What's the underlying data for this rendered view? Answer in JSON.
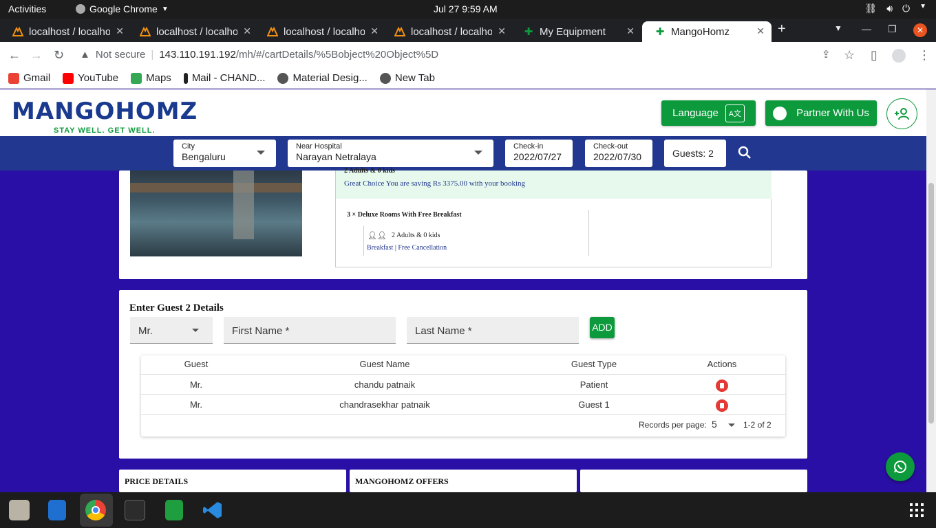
{
  "system_bar": {
    "activities": "Activities",
    "app_name": "Google Chrome",
    "clock": "Jul 27  9:59 AM"
  },
  "tabs": [
    {
      "title": "localhost / localhost",
      "active": false
    },
    {
      "title": "localhost / localhost",
      "active": false
    },
    {
      "title": "localhost / localhost",
      "active": false
    },
    {
      "title": "localhost / localhost",
      "active": false
    },
    {
      "title": "My Equipment",
      "active": false
    },
    {
      "title": "MangoHomz",
      "active": true
    }
  ],
  "omnibox": {
    "security": "Not secure",
    "url_host": "143.110.191.192",
    "url_path": "/mh/#/cartDetails/%5Bobject%20Object%5D"
  },
  "bookmarks": [
    {
      "label": "Gmail",
      "icon": "gmail-icon",
      "color": "#ea4335"
    },
    {
      "label": "YouTube",
      "icon": "youtube-icon",
      "color": "#ff0000"
    },
    {
      "label": "Maps",
      "icon": "maps-icon",
      "color": "#34a853"
    },
    {
      "label": "Mail - CHAND...",
      "icon": "mail-icon",
      "color": "#222222"
    },
    {
      "label": "Material Desig...",
      "icon": "globe-icon",
      "color": "#444444"
    },
    {
      "label": "New Tab",
      "icon": "globe-icon",
      "color": "#444444"
    }
  ],
  "site": {
    "logo_text": "MANGOHOMZ",
    "tagline": "STAY WELL. GET WELL.",
    "language_label": "Language",
    "partner_label": "Partner With Us",
    "brand_green": "#0c9a3c",
    "brand_blue": "#22378f"
  },
  "search": {
    "city_label": "City",
    "city_value": "Bengaluru",
    "hospital_label": "Near Hospital",
    "hospital_value": "Narayan Netralaya",
    "checkin_label": "Check-in",
    "checkin_value": "2022/07/27",
    "checkout_label": "Check-out",
    "checkout_value": "2022/07/30",
    "guests_label": "Guests:",
    "guests_value": "2"
  },
  "booking": {
    "occupancy_summary": "2 Adults & 0 kids",
    "savings_text": "Great Choice You are saving Rs 3375.00 with your booking",
    "room_title": "3 × Deluxe Rooms With Free Breakfast",
    "room_occupancy": "2 Adults & 0 kids",
    "room_features": "Breakfast | Free Cancellation"
  },
  "guest_form": {
    "heading": "Enter Guest 2 Details",
    "salutation": "Mr.",
    "first_name_placeholder": "First Name *",
    "last_name_placeholder": "Last Name *",
    "add_label": "ADD"
  },
  "guest_table": {
    "headers": [
      "Guest",
      "Guest Name",
      "Guest Type",
      "Actions"
    ],
    "rows": [
      {
        "guest": "Mr.",
        "name": "chandu patnaik",
        "type": "Patient"
      },
      {
        "guest": "Mr.",
        "name": "chandrasekhar patnaik",
        "type": "Guest 1"
      }
    ],
    "records_label": "Records per page:",
    "records_value": "5",
    "range": "1-2 of 2"
  },
  "bottom_panels": {
    "price_details": "PRICE DETAILS",
    "offers": "MANGOHOMZ OFFERS"
  }
}
